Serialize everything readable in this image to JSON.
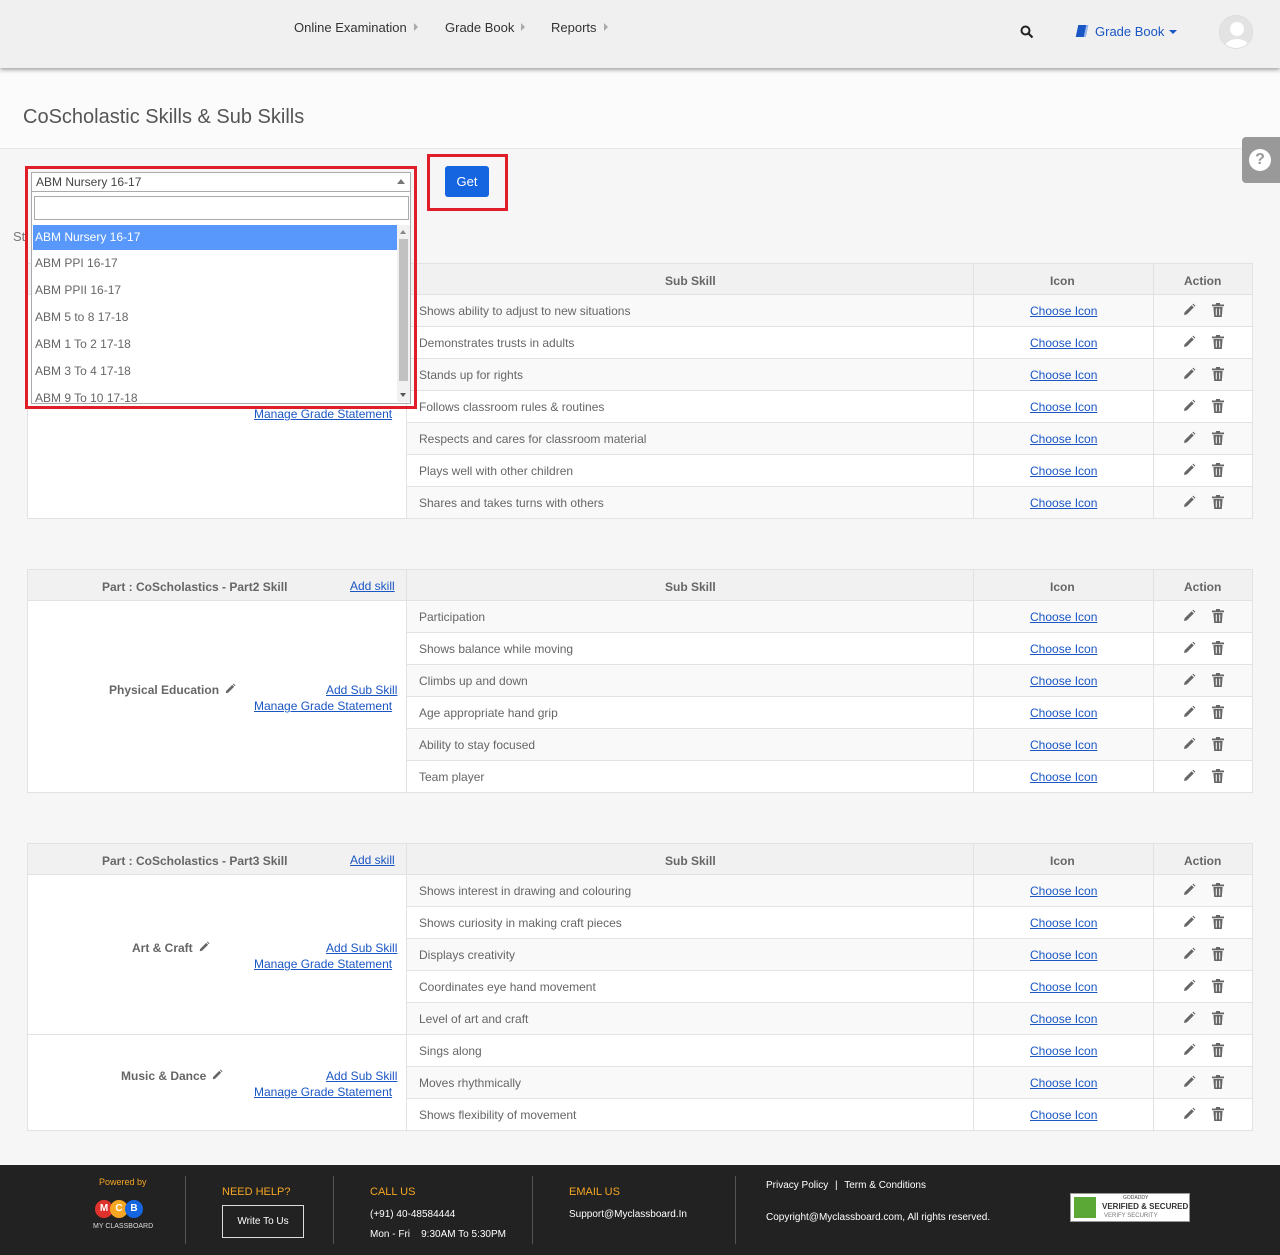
{
  "nav": {
    "items": [
      "Online Examination",
      "Grade Book",
      "Reports"
    ],
    "right_menu": "Grade Book"
  },
  "page_title": "CoScholastic Skills & Sub Skills",
  "selector": {
    "value": "ABM Nursery 16-17",
    "search_placeholder": "",
    "options": [
      "ABM Nursery 16-17",
      "ABM PPI 16-17",
      "ABM PPII 16-17",
      "ABM 5 to 8 17-18",
      "ABM 1 To 2 17-18",
      "ABM 3 To 4 17-18",
      "ABM 9 To 10 17-18"
    ]
  },
  "get_label": "Get",
  "peek_text": "St",
  "labels": {
    "add_skill": "Add skill",
    "add_sub_skill": "Add Sub Skill",
    "manage_grade_statement": "Manage Grade Statement",
    "sub_skill": "Sub Skill",
    "icon": "Icon",
    "action": "Action",
    "choose_icon": "Choose Icon"
  },
  "blocks": [
    {
      "part": "",
      "skills": [
        {
          "name": "",
          "subskills": [
            "Shows ability to adjust to new situations",
            "Demonstrates trusts in adults",
            "Stands up for rights",
            "Follows classroom rules & routines",
            "Respects and cares for classroom material",
            "Plays well with other children",
            "Shares and takes turns with others"
          ]
        }
      ]
    },
    {
      "part": "Part : CoScholastics - Part2 Skill",
      "skills": [
        {
          "name": "Physical Education",
          "subskills": [
            "Participation",
            "Shows balance while moving",
            "Climbs up and down",
            "Age appropriate hand grip",
            "Ability to stay focused",
            "Team player"
          ]
        }
      ]
    },
    {
      "part": "Part : CoScholastics - Part3 Skill",
      "skills": [
        {
          "name": "Art & Craft",
          "subskills": [
            "Shows interest in drawing and colouring",
            "Shows curiosity in making craft pieces",
            "Displays creativity",
            "Coordinates eye hand movement",
            "Level of art and craft"
          ]
        },
        {
          "name": "Music & Dance",
          "subskills": [
            "Sings along",
            "Moves rhythmically",
            "Shows flexibility of movement"
          ]
        }
      ]
    }
  ],
  "footer": {
    "powered_by": "Powered by",
    "logo_letters": [
      "M",
      "C",
      "B"
    ],
    "logo_text": "MY CLASSBOARD",
    "need_help": "NEED HELP?",
    "write_to_us": "Write To Us",
    "call_us": "CALL US",
    "phone": "(+91) 40-48584444",
    "hours": "Mon - Fri    9:30AM To 5:30PM",
    "email_us": "EMAIL US",
    "email": "Support@Myclassboard.In",
    "privacy": "Privacy Policy",
    "sep": "|",
    "terms": "Term & Conditions",
    "copyright": "Copyright@Myclassboard.com, All rights reserved.",
    "badge_line1": "GODADDY",
    "badge_line2": "VERIFIED & SECURED",
    "badge_line3": "VERIFY SECURITY"
  },
  "colors": {
    "accent": "#1565e0",
    "highlight": "#e01e2a",
    "selected_option": "#5897fb",
    "link": "#1a56c4",
    "footer_heading": "#f5a623"
  }
}
